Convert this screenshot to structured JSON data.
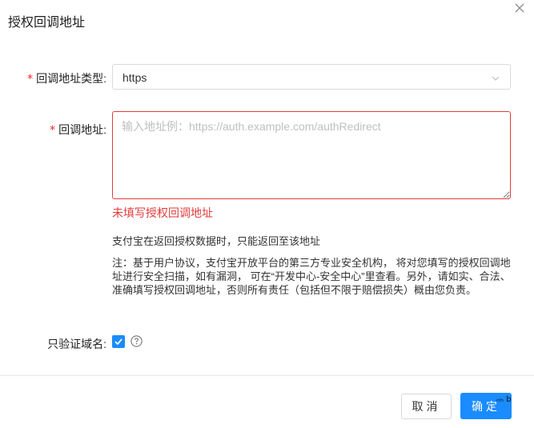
{
  "dialog": {
    "title": "授权回调地址",
    "close_icon": "close-icon"
  },
  "form": {
    "type_field": {
      "required_mark": "*",
      "label": "回调地址类型:",
      "value": "https",
      "arrow_icon": "chevron-down-icon"
    },
    "address_field": {
      "required_mark": "*",
      "label": "回调地址:",
      "value": "",
      "placeholder": "输入地址例：https://auth.example.com/authRedirect",
      "error": "未填写授权回调地址"
    },
    "tips": {
      "line1": "支付宝在返回授权数据时，只能返回至该地址",
      "line2": "注：基于用户协议，支付宝开放平台的第三方专业安全机构， 将对您填写的授权回调地址进行安全扫描，如有漏洞， 可在“开发中心-安全中心”里查看。另外，请如实、合法、准确填写授权回调地址，否则所有责任（包括但不限于赔偿损失）概由您负责。"
    },
    "domain_only": {
      "label": "只验证域名:",
      "checked": true,
      "help_icon": "help-circle-icon"
    }
  },
  "footer": {
    "cancel_label": "取消",
    "ok_label": "确定",
    "badge": "ᵣ₍ₕ b"
  },
  "colors": {
    "primary": "#1a8cff",
    "error": "#e23b3b",
    "required": "#f5222d"
  }
}
